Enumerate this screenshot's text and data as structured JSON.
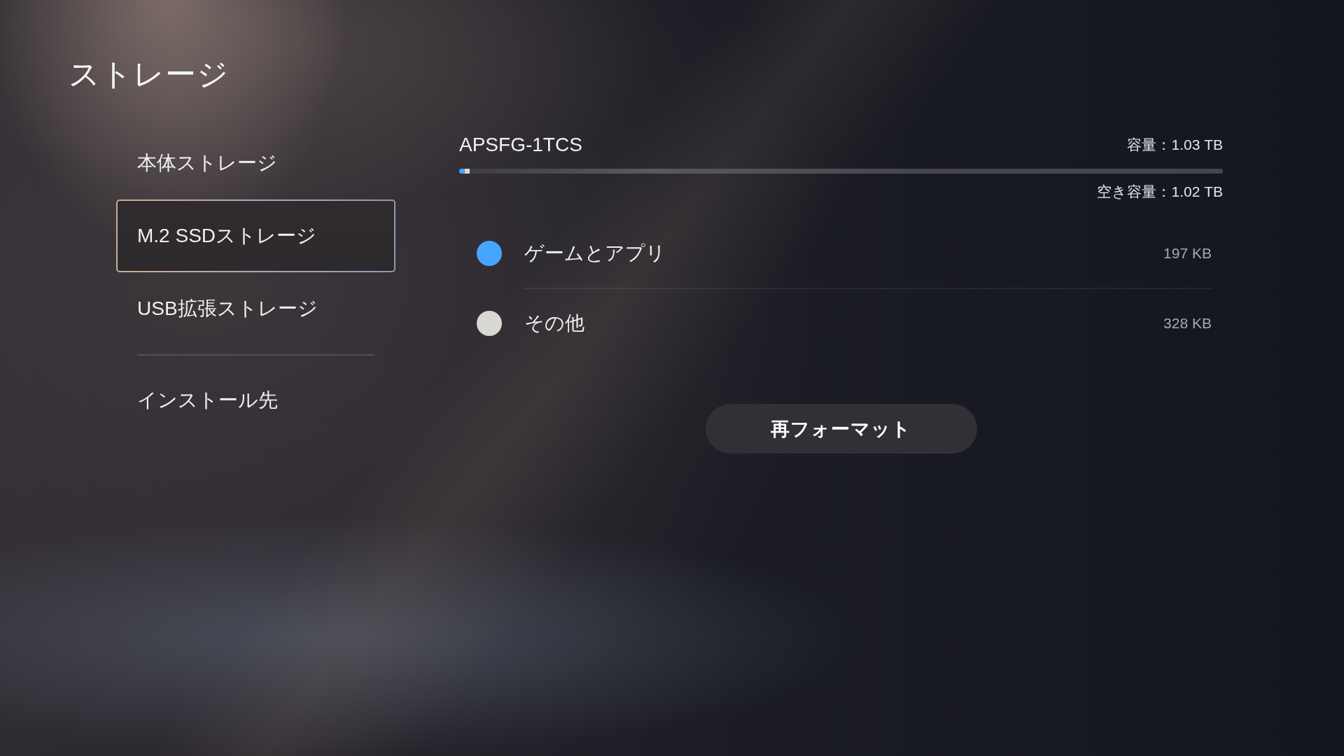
{
  "page": {
    "title": "ストレージ"
  },
  "sidebar": {
    "groups": [
      {
        "items": [
          {
            "label": "本体ストレージ",
            "selected": false
          },
          {
            "label": "M.2 SSDストレージ",
            "selected": true
          },
          {
            "label": "USB拡張ストレージ",
            "selected": false
          }
        ]
      },
      {
        "items": [
          {
            "label": "インストール先",
            "selected": false
          }
        ]
      }
    ]
  },
  "storage": {
    "device_name": "APSFG-1TCS",
    "capacity": "容量：1.03 TB",
    "free_space": "空き容量：1.02 TB",
    "categories": [
      {
        "label": "ゲームとアプリ",
        "size": "197 KB",
        "color": "#46a6ff",
        "level": 0.007
      },
      {
        "label": "その他",
        "size": "328 KB",
        "color": "#d8d7d2",
        "level": 0.007
      }
    ]
  },
  "actions": [
    {
      "label": "再フォーマット"
    }
  ]
}
